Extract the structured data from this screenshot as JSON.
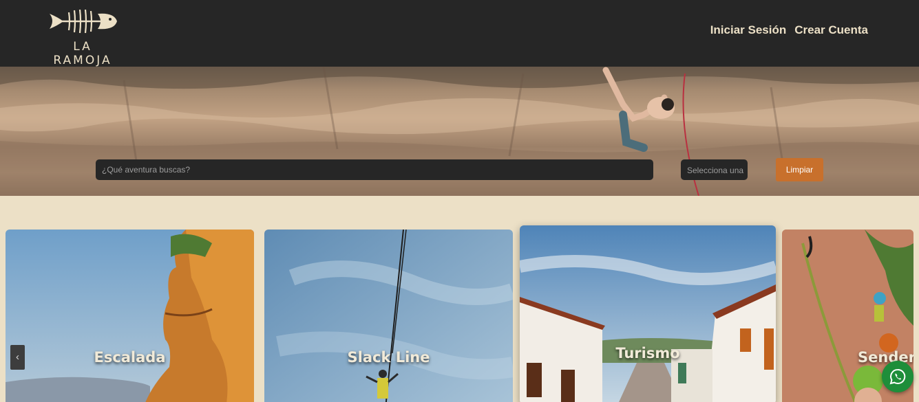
{
  "brand": {
    "name": "LA RAMOJA",
    "logo_icon": "fish-skeleton-icon"
  },
  "nav": {
    "login_label": "Iniciar Sesión",
    "signup_label": "Crear Cuenta"
  },
  "search": {
    "placeholder": "¿Qué aventura buscas?",
    "category_placeholder": "Selecciona una",
    "clear_label": "Limpiar"
  },
  "carousel": {
    "prev_label": "‹",
    "cards": [
      {
        "title": "Escalada"
      },
      {
        "title": "Slack Line"
      },
      {
        "title": "Turismo"
      },
      {
        "title": "Senderismo"
      }
    ]
  },
  "floating": {
    "whatsapp_icon": "whatsapp-icon"
  },
  "colors": {
    "header_bg": "#262626",
    "page_bg": "#ece0c6",
    "accent": "#c8702c",
    "text_light": "#ece0c6"
  }
}
